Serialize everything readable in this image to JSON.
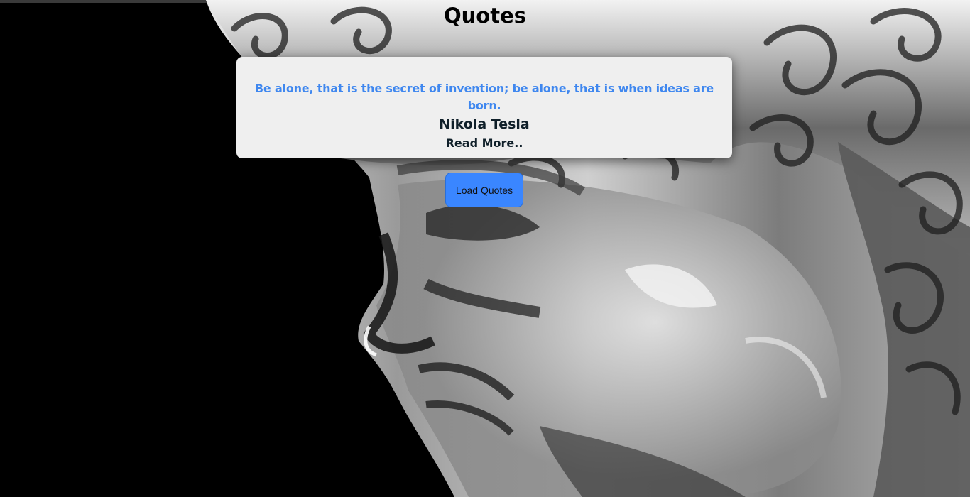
{
  "header": {
    "title": "Quotes"
  },
  "quote": {
    "text": "Be alone, that is the secret of invention; be alone, that is when ideas are born.",
    "author": "Nikola Tesla",
    "read_more_label": "Read More.."
  },
  "actions": {
    "load_label": "Load Quotes"
  },
  "colors": {
    "quote_text": "#3f87ef",
    "author_text": "#10202a",
    "button_bg": "#3a86ff",
    "card_bg": "#efefef",
    "page_bg": "#000000"
  }
}
